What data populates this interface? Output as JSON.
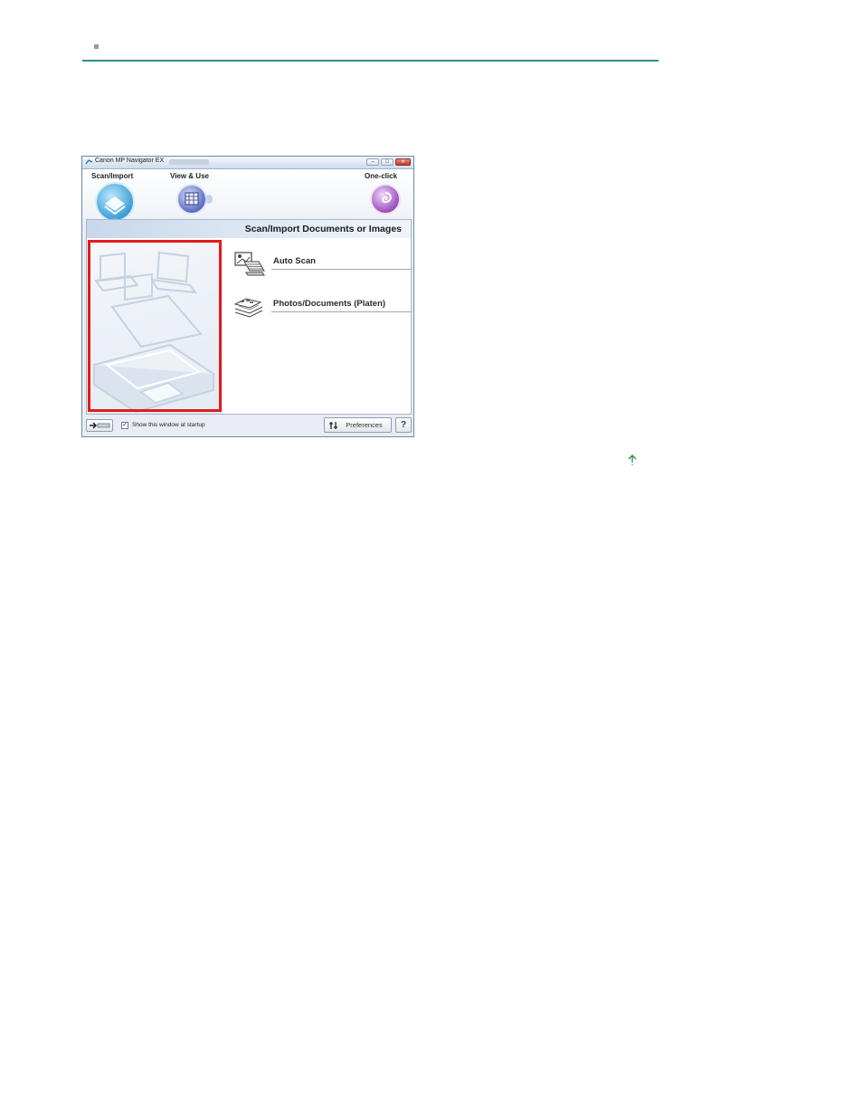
{
  "window": {
    "title": "Canon MP Navigator EX",
    "controls": {
      "minimize": "–",
      "maximize": "□",
      "close": "✕"
    }
  },
  "tabs": [
    {
      "label": "Scan/Import",
      "icon": "scanner-icon",
      "color": "#3aa0d8"
    },
    {
      "label": "View & Use",
      "icon": "grid-icon",
      "color": "#5a6fc4"
    },
    {
      "label": "One-click",
      "icon": "swirl-icon",
      "color": "#9b4fc0"
    }
  ],
  "panel": {
    "title": "Scan/Import Documents or Images",
    "items": [
      {
        "label": "Auto Scan",
        "icon": "auto-scan-icon"
      },
      {
        "label": "Photos/Documents (Platen)",
        "icon": "platen-icon"
      }
    ]
  },
  "bottom": {
    "checkbox_label": "Show this window at startup",
    "checkbox_checked": true,
    "checkbox_mark": "✓",
    "preferences_label": "Preferences",
    "help_label": "?"
  },
  "colors": {
    "rule": "#2e8f86",
    "highlight": "#e41b1b",
    "top_arrow": "#2e8b3a"
  }
}
